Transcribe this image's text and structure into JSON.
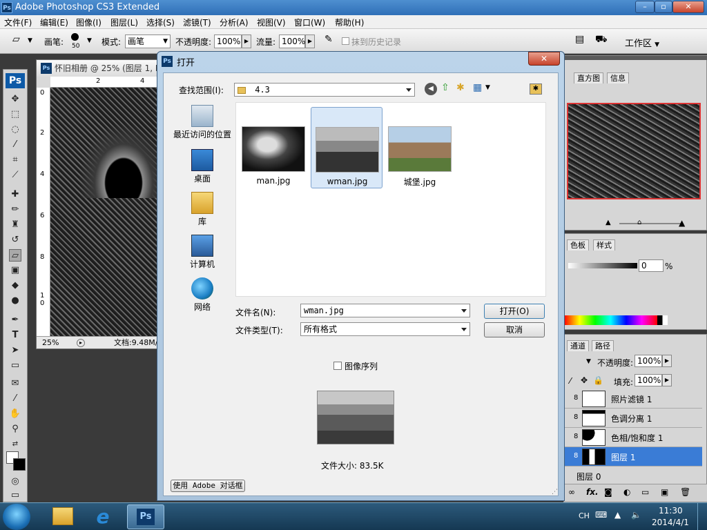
{
  "photoshop": {
    "logo": "Ps",
    "title": "Adobe Photoshop CS3 Extended",
    "window_buttons": [
      "–",
      "▫",
      "✕"
    ],
    "menu": [
      "文件(F)",
      "编辑(E)",
      "图像(I)",
      "图层(L)",
      "选择(S)",
      "滤镜(T)",
      "分析(A)",
      "视图(V)",
      "窗口(W)",
      "帮助(H)"
    ],
    "options": {
      "brush_label": "画笔:",
      "brush_size": "50",
      "mode_label": "模式:",
      "mode_value": "画笔",
      "opacity_label": "不透明度:",
      "opacity_value": "100%",
      "flow_label": "流量:",
      "flow_value": "100%",
      "history_label": "抹到历史记录",
      "workspace_label": "工作区"
    }
  },
  "document": {
    "title": "怀旧相册 @ 25% (图层 1, R",
    "zoom": "25%",
    "doc_size": "文档:9.48M/",
    "ruler_h": [
      "2",
      "4"
    ],
    "ruler_v": [
      "0",
      "2",
      "4",
      "6",
      "8",
      "1\n0"
    ]
  },
  "panels": {
    "navigator_tabs": [
      "直方图",
      "信息"
    ],
    "color_tabs": [
      "色板",
      "样式"
    ],
    "color_value": "0",
    "color_unit": "%",
    "layers_tabs": [
      "通道",
      "路径"
    ],
    "opacity_label": "不透明度:",
    "opacity_value": "100%",
    "fill_label": "填充:",
    "fill_value": "100%",
    "layers": [
      {
        "name": "照片滤镜 1",
        "selected": false
      },
      {
        "name": "色调分离 1",
        "selected": false
      },
      {
        "name": "色相/饱和度 1",
        "selected": false
      },
      {
        "name": "图层 1",
        "selected": true
      },
      {
        "name": "图层 0",
        "selected": false
      }
    ],
    "footer_fx": "fx."
  },
  "dialog": {
    "title": "打开",
    "close_label": "✕",
    "look_in_label": "查找范围(I):",
    "look_in_value": "4.3",
    "places": [
      {
        "label": "最近访问的位置",
        "icon": "recent-places-icon"
      },
      {
        "label": "桌面",
        "icon": "desktop-icon"
      },
      {
        "label": "库",
        "icon": "libraries-icon"
      },
      {
        "label": "计算机",
        "icon": "computer-icon"
      },
      {
        "label": "网络",
        "icon": "network-icon"
      }
    ],
    "files": [
      {
        "name": "man.jpg",
        "selected": false
      },
      {
        "name": "wman.jpg",
        "selected": true
      },
      {
        "name": "城堡.jpg",
        "selected": false
      }
    ],
    "filename_label": "文件名(N):",
    "filename_value": "wman.jpg",
    "filetype_label": "文件类型(T):",
    "filetype_value": "所有格式",
    "open_button": "打开(O)",
    "cancel_button": "取消",
    "image_sequence_label": "图像序列",
    "file_size": "文件大小: 83.5K",
    "adobe_dialog_button": "使用 Adobe 对话框"
  },
  "taskbar": {
    "tray_lang": "CH",
    "time": "11:30",
    "date": "2014/4/1",
    "ps_label": "Ps"
  }
}
